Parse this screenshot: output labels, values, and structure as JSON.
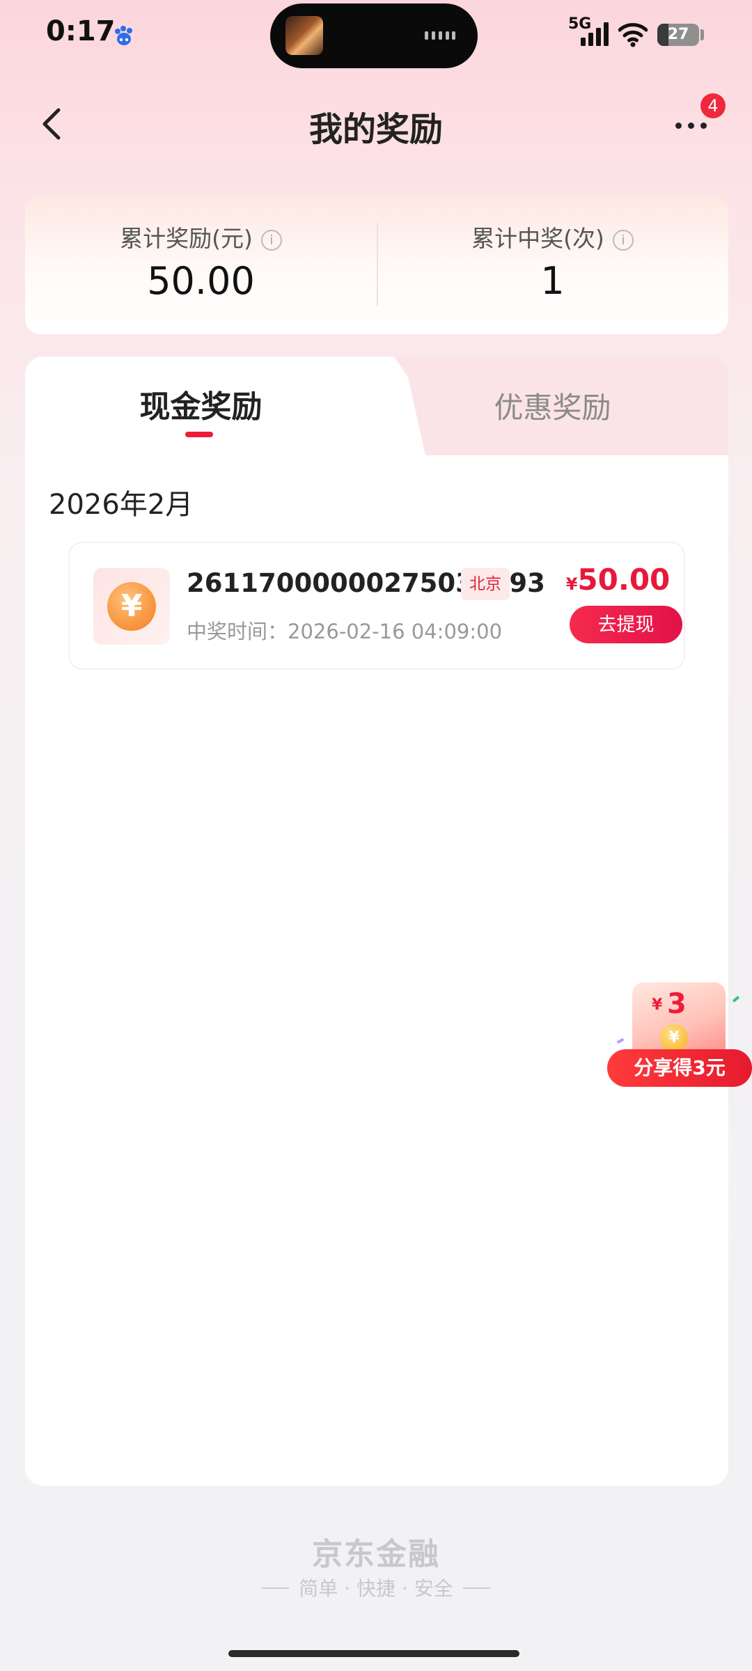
{
  "status_bar": {
    "time": "0:17",
    "network": "5G",
    "battery": "27",
    "battery_level": 0.27
  },
  "nav": {
    "title": "我的奖励",
    "notification_count": "4",
    "icons": [
      "back-arrow-icon",
      "more-icon"
    ]
  },
  "summary": {
    "total_reward_label": "累计奖励(元)",
    "total_reward_value": "50.00",
    "total_wins_label": "累计中奖(次)",
    "total_wins_value": "1",
    "info_glyph": "i"
  },
  "tabs": [
    {
      "label": "现金奖励",
      "active": true
    },
    {
      "label": "优惠奖励",
      "active": false
    }
  ],
  "rewards": {
    "month": "2026年2月",
    "items": [
      {
        "id": "26117000000275030193",
        "city": "北京",
        "time_label": "中奖时间：",
        "time_value": "2026-02-16 04:09:00",
        "currency": "¥",
        "amount": "50.00",
        "action": "去提现",
        "icon_glyph": "¥"
      }
    ]
  },
  "share_widget": {
    "currency": "¥",
    "amount": "3",
    "coin_glyph": "¥",
    "label": "分享得3元"
  },
  "footer": {
    "brand": "京东金融",
    "slogan": "简单 · 快捷 · 安全"
  },
  "colors": {
    "accent": "#ee1c3a",
    "background_top": "#fbd6dc",
    "background_bottom": "#f2f2f4",
    "card": "#ffffff"
  }
}
